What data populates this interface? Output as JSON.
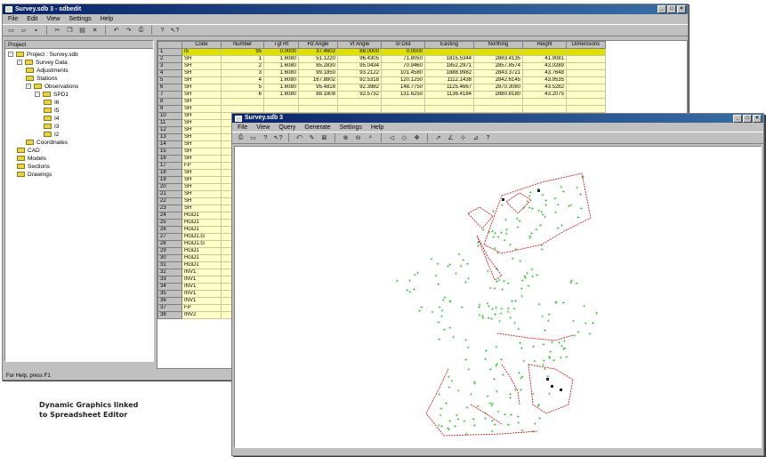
{
  "main": {
    "title": "Survey.sdb 3 - sdbedit",
    "menu": [
      "File",
      "Edit",
      "View",
      "Settings",
      "Help"
    ],
    "tree": {
      "header": "Project",
      "items": [
        {
          "label": "Project : Survey.sdb",
          "level": 0,
          "expander": "-"
        },
        {
          "label": "Survey Data",
          "level": 1,
          "expander": "-"
        },
        {
          "label": "Adjustments",
          "level": 2,
          "expander": ""
        },
        {
          "label": "Stations",
          "level": 2,
          "expander": ""
        },
        {
          "label": "Observations",
          "level": 2,
          "expander": "-"
        },
        {
          "label": "SPD1",
          "level": 3,
          "expander": "-"
        },
        {
          "label": "I6",
          "level": 4,
          "expander": ""
        },
        {
          "label": "I5",
          "level": 4,
          "expander": ""
        },
        {
          "label": "I4",
          "level": 4,
          "expander": ""
        },
        {
          "label": "I3",
          "level": 4,
          "expander": ""
        },
        {
          "label": "I2",
          "level": 4,
          "expander": ""
        },
        {
          "label": "Coordinates",
          "level": 2,
          "expander": ""
        },
        {
          "label": "CAD",
          "level": 1,
          "expander": ""
        },
        {
          "label": "Models",
          "level": 1,
          "expander": ""
        },
        {
          "label": "Sections",
          "level": 1,
          "expander": ""
        },
        {
          "label": "Drawings",
          "level": 1,
          "expander": ""
        }
      ]
    },
    "grid": {
      "columns": [
        "",
        "Code",
        "Number",
        "Tgt Ht",
        "Hz Angle",
        "Vt Angle",
        "Sl Dist",
        "Easting",
        "Northing",
        "Height",
        "Dimensions"
      ],
      "rows": [
        [
          "1",
          "I5",
          "95",
          "0.0000",
          "37.4602",
          "88.0000",
          "0.0000",
          "",
          "",
          "",
          ""
        ],
        [
          "2",
          "SH",
          "1",
          "1.6080",
          "51.1220",
          "96.4305",
          "71.8050",
          "1815.5344",
          "2883.4135",
          "41.9081",
          ""
        ],
        [
          "3",
          "SH",
          "2",
          "1.6080",
          "85.2830",
          "95.0434",
          "70.9460",
          "1852.2971",
          "2857.8574",
          "43.0289",
          ""
        ],
        [
          "4",
          "SH",
          "3",
          "1.6080",
          "99.1850",
          "93.2122",
          "101.4580",
          "1888.9982",
          "2843.3721",
          "43.7648",
          ""
        ],
        [
          "5",
          "SH",
          "4",
          "1.6080",
          "167.8802",
          "92.5318",
          "120.1250",
          "1112.1438",
          "2842.6145",
          "43.9535",
          ""
        ],
        [
          "6",
          "SH",
          "5",
          "1.6080",
          "95.4818",
          "92.3982",
          "148.7750",
          "1125.4667",
          "2870.3080",
          "43.5282",
          ""
        ],
        [
          "7",
          "SH",
          "6",
          "1.6080",
          "88.1808",
          "92.5732",
          "131.6250",
          "1136.4184",
          "2880.8180",
          "43.2075",
          ""
        ],
        [
          "8",
          "SH",
          "",
          "",
          "",
          "",
          "",
          "",
          "",
          "",
          ""
        ],
        [
          "9",
          "SH",
          "",
          "",
          "",
          "",
          "",
          "",
          "",
          "",
          ""
        ],
        [
          "10",
          "SH",
          "",
          "",
          "",
          "",
          "",
          "",
          "",
          "",
          ""
        ],
        [
          "11",
          "SH",
          "",
          "",
          "",
          "",
          "",
          "",
          "",
          "",
          ""
        ],
        [
          "12",
          "SH",
          "",
          "",
          "",
          "",
          "",
          "",
          "",
          "",
          ""
        ],
        [
          "13",
          "SH",
          "",
          "",
          "",
          "",
          "",
          "",
          "",
          "",
          ""
        ],
        [
          "14",
          "SH",
          "",
          "",
          "",
          "",
          "",
          "",
          "",
          "",
          ""
        ],
        [
          "15",
          "SH",
          "",
          "",
          "",
          "",
          "",
          "",
          "",
          "",
          ""
        ],
        [
          "16",
          "SH",
          "",
          "",
          "",
          "",
          "",
          "",
          "",
          "",
          ""
        ],
        [
          "17",
          "FP",
          "",
          "",
          "",
          "",
          "",
          "",
          "",
          "",
          ""
        ],
        [
          "18",
          "SH",
          "",
          "",
          "",
          "",
          "",
          "",
          "",
          "",
          ""
        ],
        [
          "19",
          "SH",
          "",
          "",
          "",
          "",
          "",
          "",
          "",
          "",
          ""
        ],
        [
          "20",
          "SH",
          "",
          "",
          "",
          "",
          "",
          "",
          "",
          "",
          ""
        ],
        [
          "21",
          "SH",
          "",
          "",
          "",
          "",
          "",
          "",
          "",
          "",
          ""
        ],
        [
          "22",
          "SH",
          "",
          "",
          "",
          "",
          "",
          "",
          "",
          "",
          ""
        ],
        [
          "23",
          "SH",
          "",
          "",
          "",
          "",
          "",
          "",
          "",
          "",
          ""
        ],
        [
          "24",
          "HGD1",
          "",
          "",
          "",
          "",
          "",
          "",
          "",
          "",
          ""
        ],
        [
          "25",
          "HGD1",
          "",
          "",
          "",
          "",
          "",
          "",
          "",
          "",
          ""
        ],
        [
          "26",
          "HGD1",
          "",
          "",
          "",
          "",
          "",
          "",
          "",
          "",
          ""
        ],
        [
          "27",
          "HGD1.G",
          "",
          "",
          "",
          "",
          "",
          "",
          "",
          "",
          ""
        ],
        [
          "28",
          "HGD1.G",
          "",
          "",
          "",
          "",
          "",
          "",
          "",
          "",
          ""
        ],
        [
          "29",
          "HGD1",
          "",
          "",
          "",
          "",
          "",
          "",
          "",
          "",
          ""
        ],
        [
          "30",
          "HGD1",
          "",
          "",
          "",
          "",
          "",
          "",
          "",
          "",
          ""
        ],
        [
          "31",
          "HGD1",
          "",
          "",
          "",
          "",
          "",
          "",
          "",
          "",
          ""
        ],
        [
          "32",
          "INV1",
          "",
          "",
          "",
          "",
          "",
          "",
          "",
          "",
          ""
        ],
        [
          "33",
          "INV1",
          "",
          "",
          "",
          "",
          "",
          "",
          "",
          "",
          ""
        ],
        [
          "34",
          "INV1",
          "",
          "",
          "",
          "",
          "",
          "",
          "",
          "",
          ""
        ],
        [
          "35",
          "INV1",
          "",
          "",
          "",
          "",
          "",
          "",
          "",
          "",
          ""
        ],
        [
          "36",
          "INV1",
          "",
          "",
          "",
          "",
          "",
          "",
          "",
          "",
          ""
        ],
        [
          "37",
          "FP",
          "",
          "",
          "",
          "",
          "",
          "",
          "",
          "",
          ""
        ],
        [
          "38",
          "INV2",
          "",
          "",
          "",
          "",
          "",
          "",
          "",
          "",
          ""
        ]
      ]
    },
    "status": "For Help, press F1"
  },
  "graphics": {
    "title": "Survey.sdb 3",
    "menu": [
      "File",
      "View",
      "Query",
      "Generate",
      "Settings",
      "Help"
    ]
  },
  "caption": {
    "line1": "Dynamic Graphics linked",
    "line2": "to Spreadsheet Editor"
  },
  "colors": {
    "titlebar": "#0a246a",
    "row_fill": "#ffffc8",
    "row_selected": "#e0e000",
    "point_green": "#3fbf3f",
    "line_red": "#c0282c"
  }
}
